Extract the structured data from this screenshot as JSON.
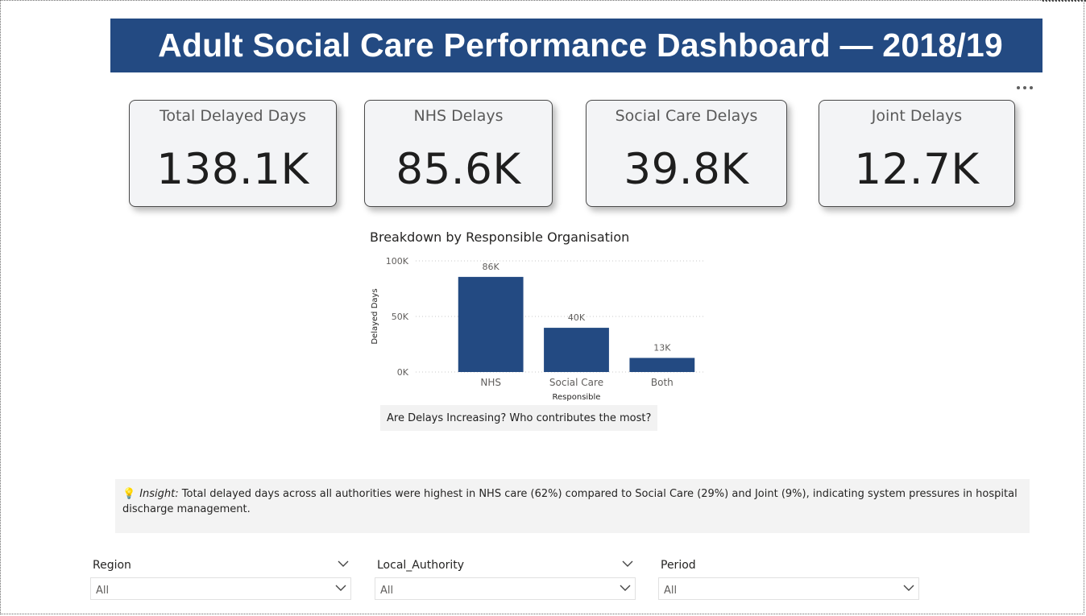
{
  "title": "Adult Social Care Performance Dashboard — 2018/19",
  "more_options_icon": "ellipsis-icon",
  "kpis": [
    {
      "label": "Total Delayed Days",
      "value": "138.1K"
    },
    {
      "label": "NHS Delays",
      "value": "85.6K"
    },
    {
      "label": "Social Care Delays",
      "value": "39.8K"
    },
    {
      "label": "Joint Delays",
      "value": "12.7K"
    }
  ],
  "chart_data": {
    "type": "bar",
    "title": "Breakdown by Responsible Organisation",
    "categories": [
      "NHS",
      "Social Care",
      "Both"
    ],
    "values": [
      85.6,
      39.8,
      12.7
    ],
    "data_labels": [
      "86K",
      "40K",
      "13K"
    ],
    "unit": "K",
    "xlabel": "Responsible",
    "ylabel": "Delayed Days",
    "ylim": [
      0,
      100
    ],
    "yticks": [
      "0K",
      "50K",
      "100K"
    ],
    "grid": true,
    "bar_color": "#234a82"
  },
  "question": "Are Delays Increasing? Who contributes the most?",
  "insight": {
    "icon": "lightbulb-icon",
    "label": "Insight:",
    "text": "Total delayed days across all authorities were highest in NHS care (62%) compared to Social Care (29%) and Joint (9%), indicating system pressures in hospital discharge management."
  },
  "slicers": [
    {
      "label": "Region",
      "value": "All"
    },
    {
      "label": "Local_Authority",
      "value": "All"
    },
    {
      "label": "Period",
      "value": "All"
    }
  ],
  "colors": {
    "title_bar": "#234a82",
    "card_bg": "#f3f4f6",
    "panel_bg": "#f3f3f3"
  }
}
